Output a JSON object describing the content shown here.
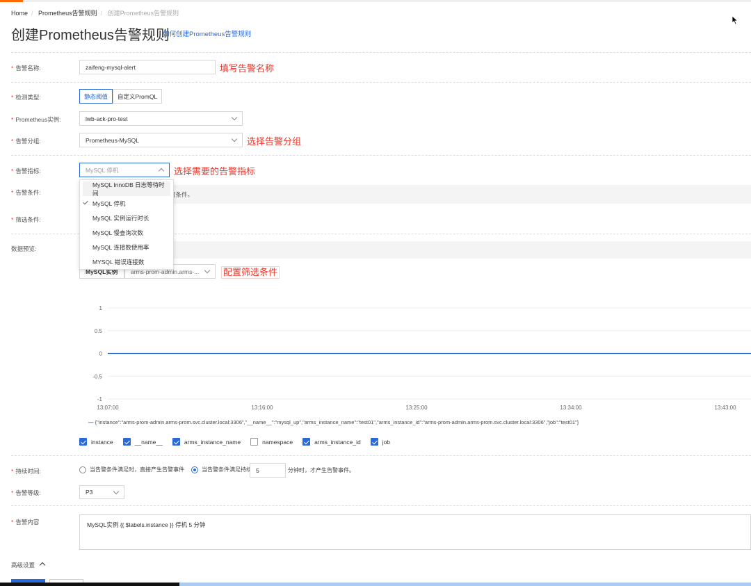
{
  "breadcrumb": [
    "Home",
    "Prometheus告警规则",
    "创建Prometheus告警规则"
  ],
  "page_title": "创建Prometheus告警规则",
  "help_link": "如何创建Prometheus告警规则",
  "form": {
    "name": {
      "label": "告警名称:",
      "value": "zaifeng-mysql-alert",
      "note": "填写告警名称"
    },
    "detect_type": {
      "label": "检测类型:",
      "options": [
        "静态阈值",
        "自定义PromQL"
      ],
      "selected": "静态阈值"
    },
    "instance": {
      "label": "Prometheus实例:",
      "value": "lwb-ack-pro-test"
    },
    "group": {
      "label": "告警分组:",
      "value": "Prometheus-MySQL",
      "note": "选择告警分组"
    },
    "metric": {
      "label": "告警指标:",
      "value": "MySQL 停机",
      "note": "选择需要的告警指标",
      "options": [
        "MySQL InnoDB 日志等待时间",
        "MySQL 停机",
        "MySQL 实例运行时长",
        "MySQL 慢查询次数",
        "MySQL 连接数使用率",
        "MYSQL 错误连接数"
      ],
      "selected_index": 1
    },
    "condition": {
      "label": "告警条件:",
      "partial_text": "置条件。"
    },
    "filter": {
      "label": "筛选条件:",
      "key": "MySQL实例",
      "value": "arms-prom-admin.arms-...",
      "note": "配置筛选条件"
    },
    "preview": {
      "label": "数据预览:"
    },
    "duration": {
      "label": "持续时间:",
      "option1": "当告警条件满足时，直接产生告警事件",
      "option2": "当告警条件满足持续",
      "minutes": "5",
      "suffix": "分钟时，才产生告警事件。",
      "selected": 2
    },
    "level": {
      "label": "告警等级:",
      "value": "P3"
    },
    "content": {
      "label": "告警内容",
      "value": "MySQL实例 {{ $labels.instance }} 停机 5 分钟"
    },
    "advanced": "高级设置"
  },
  "label_checkboxes": [
    {
      "label": "instance",
      "checked": true
    },
    {
      "label": "__name__",
      "checked": true
    },
    {
      "label": "arms_instance_name",
      "checked": true
    },
    {
      "label": "namespace",
      "checked": false
    },
    {
      "label": "arms_instance_id",
      "checked": true
    },
    {
      "label": "job",
      "checked": true
    }
  ],
  "colors": {
    "accent": "#2a6ad8",
    "required": "#e8392e",
    "series": "#2a6ad8",
    "brand": "#ff6a00"
  },
  "chart_data": {
    "type": "line",
    "x_ticks": [
      "13:07:00",
      "13:16:00",
      "13:25:00",
      "13:34:00",
      "13:43:00"
    ],
    "y_ticks": [
      "1",
      "0.5",
      "0",
      "-0.5",
      "-1"
    ],
    "ylim": [
      -1,
      1
    ],
    "grid": "horizontal",
    "legend_position": "bottom",
    "series": [
      {
        "name": "{\"instance\":\"arms-prom-admin.arms-prom.svc.cluster.local:3306\",\"__name__\":\"mysql_up\",\"arms_instance_name\":\"test01\",\"arms_instance_id\":\"arms-prom-admin.arms-prom.svc.cluster.local:3306\",\"job\":\"test01\"}",
        "x": [
          "13:07:00",
          "13:43:00"
        ],
        "values": [
          0,
          0
        ]
      }
    ]
  }
}
